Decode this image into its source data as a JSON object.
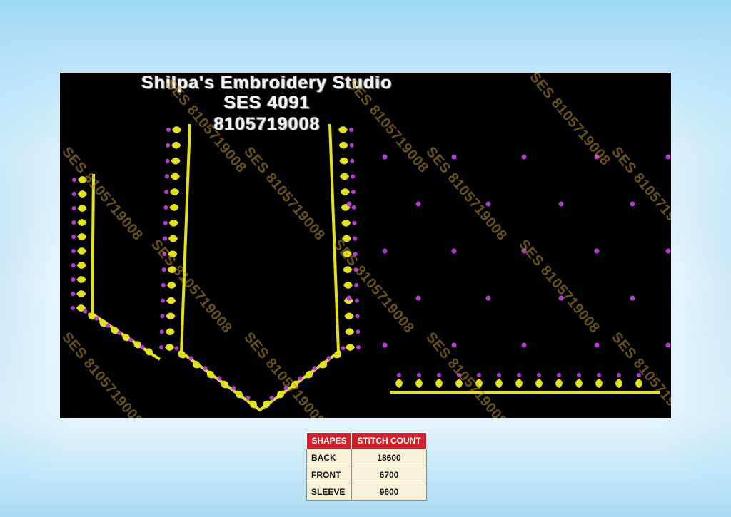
{
  "header": {
    "studio_name": "Shilpa's Embroidery Studio",
    "design_code": "SES 4091",
    "phone": "8105719008"
  },
  "watermark": "SES 8105719008",
  "colors": {
    "background": "#000000",
    "thread_yellow": "#e6e21a",
    "thread_magenta": "#b93bd6",
    "table_header": "#d4202a"
  },
  "table": {
    "headers": [
      "SHAPES",
      "STITCH COUNT"
    ],
    "rows": [
      {
        "shape": "BACK",
        "count": "18600"
      },
      {
        "shape": "FRONT",
        "count": "6700"
      },
      {
        "shape": "SLEEVE",
        "count": "9600"
      }
    ]
  }
}
